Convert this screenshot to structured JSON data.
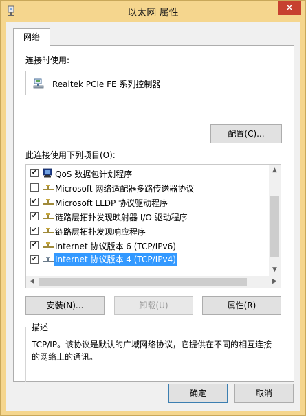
{
  "window": {
    "title": "以太网 属性",
    "close_glyph": "✕",
    "close_color": "#c7412f",
    "frame_color": "#f5d68e"
  },
  "tabs": [
    {
      "label": "网络",
      "selected": true
    }
  ],
  "connect_using": {
    "label": "连接时使用:",
    "adapter_icon": "network-adapter-icon",
    "adapter_name": "Realtek PCIe FE 系列控制器"
  },
  "configure_button": "配置(C)...",
  "items_label": "此连接使用下列项目(O):",
  "items": [
    {
      "checked": true,
      "icon": "qos-icon",
      "label": "QoS 数据包计划程序"
    },
    {
      "checked": false,
      "icon": "protocol-icon",
      "label": "Microsoft 网络适配器多路传送器协议"
    },
    {
      "checked": true,
      "icon": "protocol-icon",
      "label": "Microsoft LLDP 协议驱动程序"
    },
    {
      "checked": true,
      "icon": "protocol-icon",
      "label": "链路层拓扑发现映射器 I/O 驱动程序"
    },
    {
      "checked": true,
      "icon": "protocol-icon",
      "label": "链路层拓扑发现响应程序"
    },
    {
      "checked": true,
      "icon": "protocol-icon",
      "label": "Internet 协议版本 6 (TCP/IPv6)"
    },
    {
      "checked": true,
      "icon": "protocol-icon",
      "label": "Internet 协议版本 4 (TCP/IPv4)",
      "selected": true
    }
  ],
  "check_glyph": "✔",
  "buttons": {
    "install": "安装(N)...",
    "uninstall": "卸载(U)",
    "properties": "属性(R)",
    "ok": "确定",
    "cancel": "取消"
  },
  "description": {
    "title": "描述",
    "text": "TCP/IP。该协议是默认的广域网络协议，它提供在不同的相互连接的网络上的通讯。"
  },
  "colors": {
    "selection": "#3399ff",
    "default_button_border": "#3c7fb1"
  }
}
